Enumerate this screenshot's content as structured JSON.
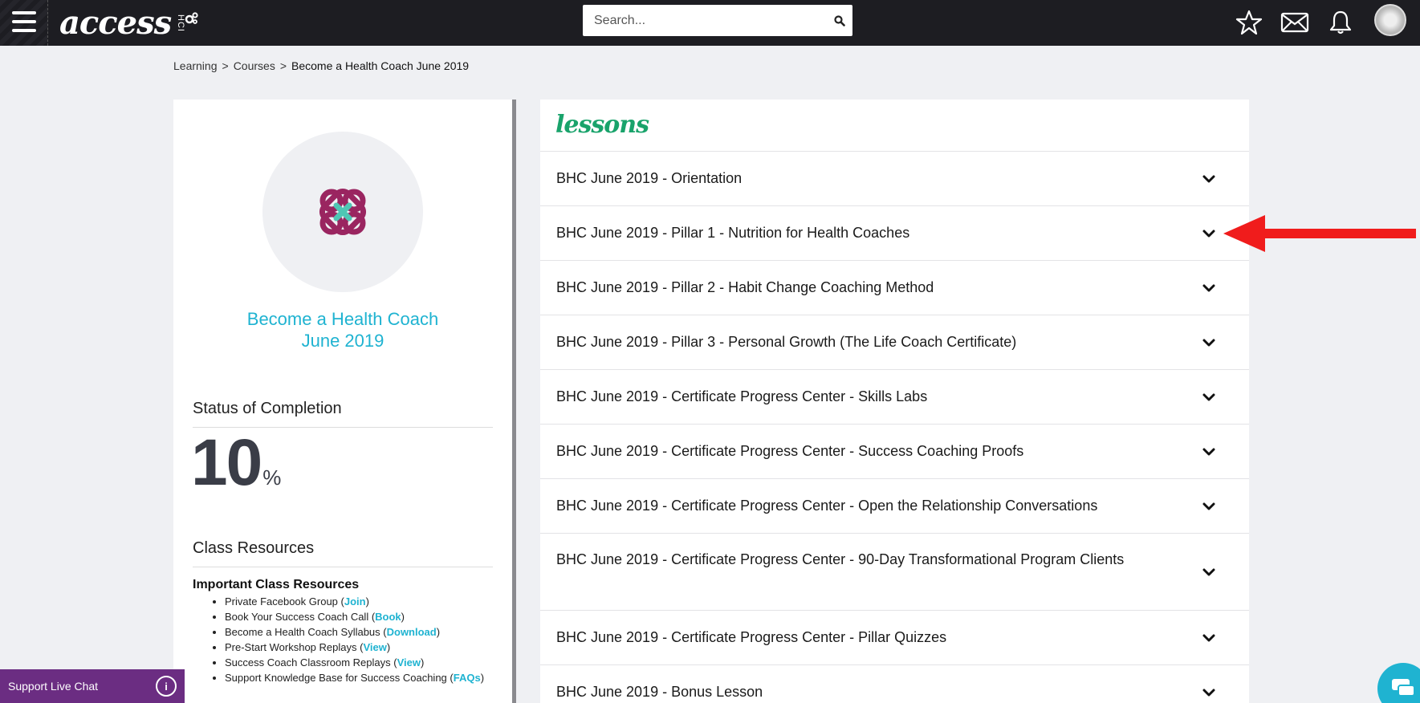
{
  "topbar": {
    "logo_text": "access",
    "logo_sub": "HCI",
    "search_placeholder": "Search..."
  },
  "breadcrumb": {
    "items": [
      "Learning",
      "Courses"
    ],
    "separator": ">",
    "current": "Become a Health Coach June 2019"
  },
  "course": {
    "title_line1": "Become a Health Coach",
    "title_line2": "June 2019",
    "status_heading": "Status of Completion",
    "completion_value": "10",
    "completion_symbol": "%",
    "resources_heading": "Class Resources",
    "important_heading": "Important Class Resources",
    "resources": [
      {
        "text": "Private Facebook Group (",
        "link": "Join",
        "end": ")"
      },
      {
        "text": "Book Your Success Coach Call (",
        "link": "Book",
        "end": ")"
      },
      {
        "text": "Become a Health Coach Syllabus (",
        "link": "Download",
        "end": ")"
      },
      {
        "text": "Pre-Start Workshop Replays (",
        "link": "View",
        "end": ")"
      },
      {
        "text": "Success Coach Classroom Replays (",
        "link": "View",
        "end": ")"
      },
      {
        "text": "Support Knowledge Base for Success Coaching (",
        "link": "FAQs",
        "end": ")"
      }
    ]
  },
  "lessons": {
    "heading": "lessons",
    "items": [
      "BHC June 2019 - Orientation",
      "BHC June 2019 - Pillar 1 - Nutrition for Health Coaches",
      "BHC June 2019 - Pillar 2 - Habit Change Coaching Method",
      "BHC June 2019 - Pillar 3 - Personal Growth (The Life Coach Certificate)",
      "BHC June 2019 - Certificate Progress Center - Skills Labs",
      "BHC June 2019 - Certificate Progress Center - Success Coaching Proofs",
      "BHC June 2019 - Certificate Progress Center - Open the Relationship Conversations",
      "BHC June 2019 - Certificate Progress Center - 90-Day Transformational Program Clients",
      "BHC June 2019 - Certificate Progress Center - Pillar Quizzes",
      "BHC June 2019 - Bonus Lesson"
    ]
  },
  "support": {
    "label": "Support Live Chat"
  },
  "colors": {
    "accent_teal": "#1fb3d1",
    "lessons_green": "#19a36b",
    "topbar": "#1d1d22",
    "support_purple": "#6b2d82",
    "annotation_red": "#f01c1c"
  },
  "icons": [
    "hamburger-icon",
    "gears-icon",
    "search-icon",
    "star-icon",
    "mail-icon",
    "bell-icon",
    "chevron-down-icon",
    "chat-icon",
    "support-chat-icon"
  ]
}
